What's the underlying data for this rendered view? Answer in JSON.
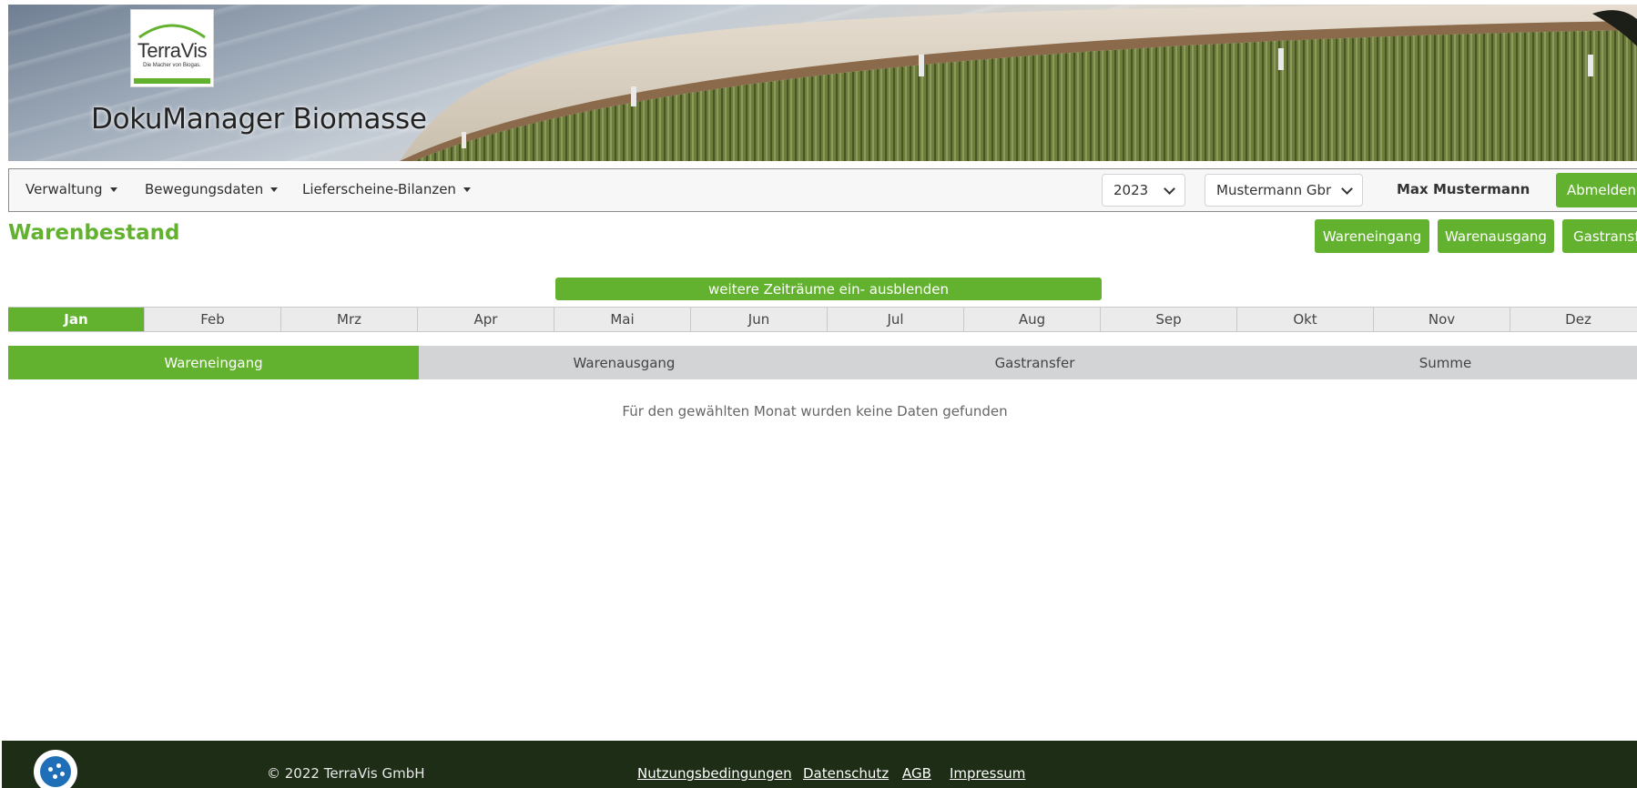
{
  "header": {
    "logo_name": "TerraVis",
    "logo_tagline": "Die Macher von Biogas.",
    "app_title": "DokuManager Biomasse"
  },
  "nav": {
    "menus": [
      "Verwaltung",
      "Bewegungsdaten",
      "Lieferscheine-Bilanzen"
    ],
    "year": "2023",
    "company": "Mustermann Gbr",
    "user": "Max Mustermann",
    "logout": "Abmelden"
  },
  "page": {
    "title": "Warenbestand",
    "actions": [
      "Wareneingang",
      "Warenausgang",
      "Gastransfer"
    ],
    "toggle_label": "weitere Zeiträume ein- ausblenden",
    "months": [
      "Jan",
      "Feb",
      "Mrz",
      "Apr",
      "Mai",
      "Jun",
      "Jul",
      "Aug",
      "Sep",
      "Okt",
      "Nov",
      "Dez"
    ],
    "active_month": "Jan",
    "tabs": [
      "Wareneingang",
      "Warenausgang",
      "Gastransfer",
      "Summe"
    ],
    "active_tab": "Wareneingang",
    "empty_message": "Für den gewählten Monat wurden keine Daten gefunden"
  },
  "footer": {
    "copyright": "© 2022 TerraVis GmbH",
    "links": [
      "Nutzungsbedingungen",
      "Datenschutz",
      "AGB",
      "Impressum"
    ]
  },
  "colors": {
    "accent": "#63b22f",
    "footer_bg": "#1e2d16",
    "tank_green": "#6a7a3a"
  },
  "icons": [
    "cookie-settings-icon",
    "chevron-down-icon",
    "caret-down-icon"
  ]
}
